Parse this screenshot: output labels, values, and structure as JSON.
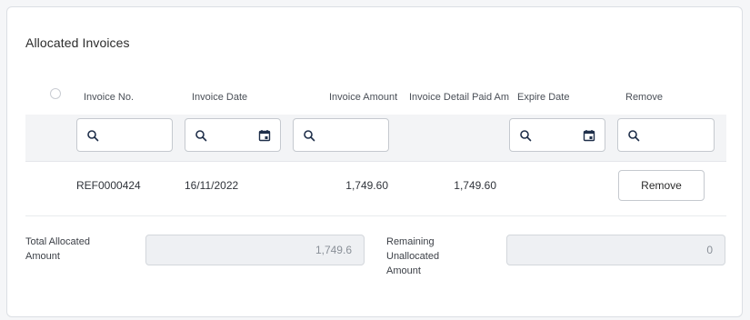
{
  "section": {
    "title": "Allocated Invoices"
  },
  "table": {
    "columns": [
      "Invoice No.",
      "Invoice Date",
      "Invoice Amount",
      "Invoice Detail Paid Amou",
      "Expire Date",
      "Remove"
    ],
    "filters": {
      "invoice_no": "",
      "invoice_date": "",
      "invoice_amount": "",
      "expire_date": "",
      "remove": ""
    },
    "rows": [
      {
        "invoice_no": "REF0000424",
        "invoice_date": "16/11/2022",
        "invoice_amount": "1,749.60",
        "detail_paid_amount": "1,749.60",
        "expire_date": "",
        "action_label": "Remove"
      }
    ]
  },
  "totals": {
    "allocated_label": "Total Allocated Amount",
    "allocated_value": "1,749.6",
    "remaining_label": "Remaining Unallocated Amount",
    "remaining_value": "0"
  },
  "icons": {
    "search": "search-icon",
    "calendar": "calendar-icon"
  },
  "colors": {
    "icon": "#1f2f4a",
    "filter_band": "#f3f4f6",
    "readonly_field": "#eef0f3"
  }
}
